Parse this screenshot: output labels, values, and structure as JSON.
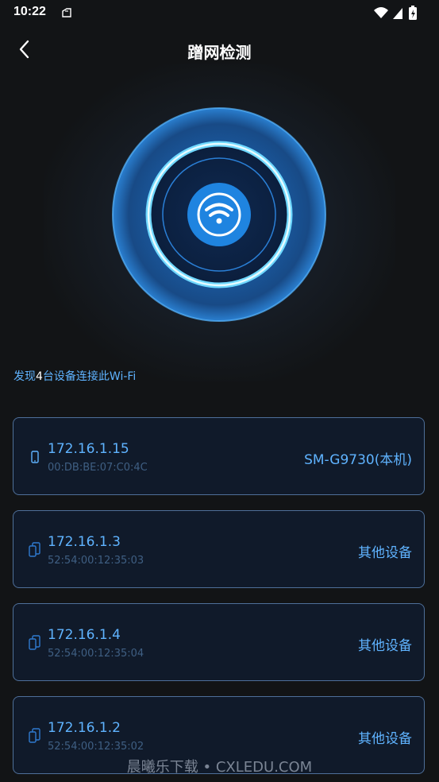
{
  "status_bar": {
    "time": "10:22"
  },
  "header": {
    "title": "蹭网检测"
  },
  "summary": {
    "prefix": "发现",
    "count": "4",
    "suffix": "台设备连接此Wi-Fi"
  },
  "devices": [
    {
      "ip": "172.16.1.15",
      "mac": "00:DB:BE:07:C0:4C",
      "name": "SM-G9730(本机)",
      "type": "phone"
    },
    {
      "ip": "172.16.1.3",
      "mac": "52:54:00:12:35:03",
      "name": "其他设备",
      "type": "devices"
    },
    {
      "ip": "172.16.1.4",
      "mac": "52:54:00:12:35:04",
      "name": "其他设备",
      "type": "devices"
    },
    {
      "ip": "172.16.1.2",
      "mac": "52:54:00:12:35:02",
      "name": "其他设备",
      "type": "devices"
    }
  ],
  "watermark": "晨曦乐下载 • CXLEDU.COM",
  "colors": {
    "accent": "#5fb3ff",
    "card_border": "#4e6f99",
    "card_bg": "#101a2a",
    "background": "#121416"
  }
}
